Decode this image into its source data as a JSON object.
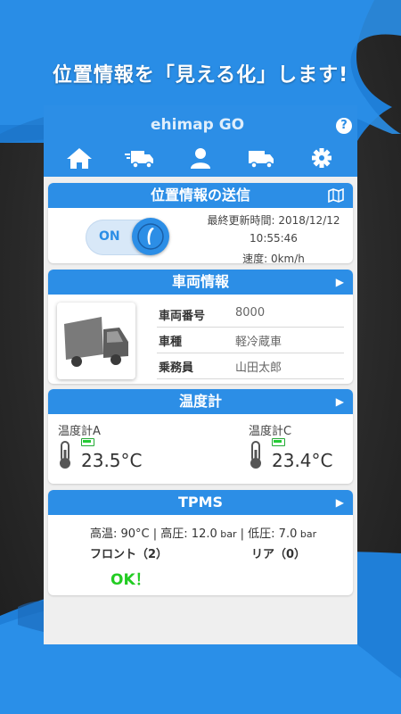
{
  "banner": {
    "headline": "位置情報を「見える化」します!"
  },
  "appbar": {
    "logo_text": "ehimap GO",
    "help_label": "?",
    "tabs": [
      {
        "icon": "home-icon"
      },
      {
        "icon": "truck-fast-icon"
      },
      {
        "icon": "user-icon"
      },
      {
        "icon": "truck-icon"
      },
      {
        "icon": "gear-icon"
      }
    ]
  },
  "location_card": {
    "title": "位置情報の送信",
    "toggle_label": "ON",
    "last_update_label": "最終更新時間: 2018/12/12",
    "last_update_time": "10:55:46",
    "speed": "速度: 0km/h"
  },
  "vehicle_card": {
    "title": "車両情報",
    "rows": [
      {
        "key": "車両番号",
        "value": "8000"
      },
      {
        "key": "車種",
        "value": "軽冷蔵車"
      },
      {
        "key": "乗務員",
        "value": "山田太郎"
      }
    ]
  },
  "thermo_card": {
    "title": "温度計",
    "sensors": [
      {
        "label": "温度計A",
        "value": "23.5°C"
      },
      {
        "label": "温度計C",
        "value": "23.4°C"
      }
    ]
  },
  "tpms_card": {
    "title": "TPMS",
    "high_temp": "高温: 90°C",
    "sep1": " | ",
    "high_press": "高圧: 12.0",
    "bar1": " bar",
    "sep2": " | ",
    "low_press": "低圧: 7.0",
    "bar2": " bar",
    "front": "フロント（2）",
    "rear": "リア（0）",
    "status": "OK！"
  },
  "colors": {
    "brand_blue": "#2c8ee6",
    "ok_green": "#22cc22"
  }
}
